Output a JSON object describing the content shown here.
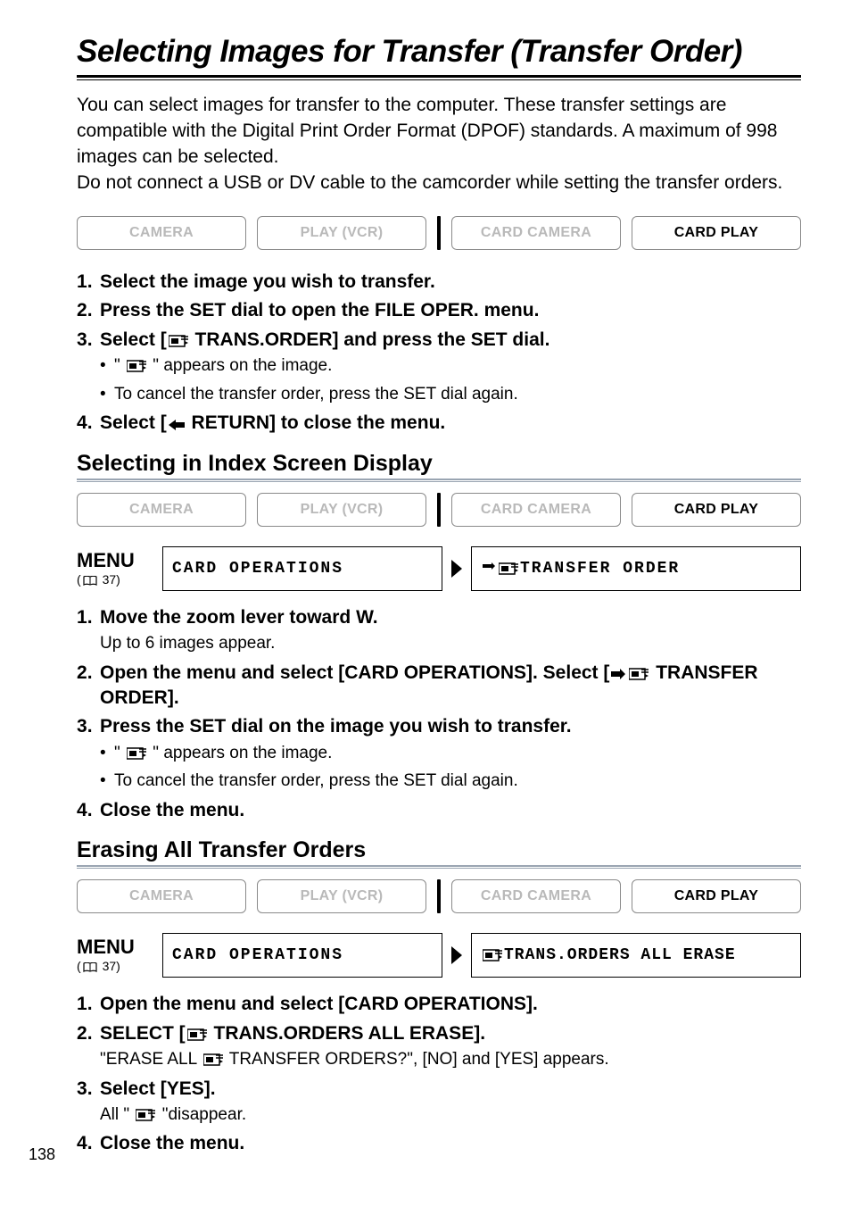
{
  "pageNumber": "138",
  "title": "Selecting Images for Transfer (Transfer Order)",
  "intro_line1": "You can select images for transfer to the computer. These transfer settings are compatible with the Digital Print Order Format (DPOF) standards. A maximum of 998 images can be selected.",
  "intro_line2": "Do not connect a USB or DV cable to the camcorder while setting the transfer orders.",
  "modes": {
    "camera": "CAMERA",
    "play": "PLAY (VCR)",
    "card_camera": "CARD CAMERA",
    "card_play": "CARD PLAY"
  },
  "menu": {
    "label": "MENU",
    "ref": "37",
    "card_ops": "CARD OPERATIONS",
    "transfer_order": "TRANSFER ORDER",
    "trans_all_erase": "TRANS.ORDERS ALL ERASE"
  },
  "steps_main": {
    "s1": "Select the image you wish to transfer.",
    "s2": "Press the SET dial to open the FILE OPER. menu.",
    "s3_a": "Select [",
    "s3_b": " TRANS.ORDER] and press the SET dial.",
    "s3_sub1_a": "\" ",
    "s3_sub1_b": " \" appears on the image.",
    "s3_sub2": "To cancel the transfer order, press the SET dial again.",
    "s4_a": "Select [",
    "s4_b": " RETURN] to close the menu."
  },
  "section2_title": "Selecting in Index Screen Display",
  "steps_index": {
    "s1_a": "Move the zoom lever toward ",
    "s1_b": "W",
    "s1_c": ".",
    "s1_sub": "Up to 6 images appear.",
    "s2_a": "Open the menu and select [CARD OPERATIONS]. Select [",
    "s2_b": " TRANSFER ORDER].",
    "s3": "Press the SET dial on the image you wish to transfer.",
    "s3_sub1_a": "\" ",
    "s3_sub1_b": " \" appears on the image.",
    "s3_sub2": "To cancel the transfer order, press the SET dial again.",
    "s4": "Close the menu."
  },
  "section3_title": "Erasing All Transfer Orders",
  "steps_erase": {
    "s1": "Open the menu and select [CARD OPERATIONS].",
    "s2_a": "SELECT [",
    "s2_b": " TRANS.ORDERS ALL ERASE].",
    "s2_sub_a": "\"ERASE ALL ",
    "s2_sub_b": " TRANSFER ORDERS?\", [NO] and [YES] appears.",
    "s3": "Select [YES].",
    "s3_sub_a": "All \" ",
    "s3_sub_b": " \"disappear.",
    "s4": "Close the menu."
  }
}
